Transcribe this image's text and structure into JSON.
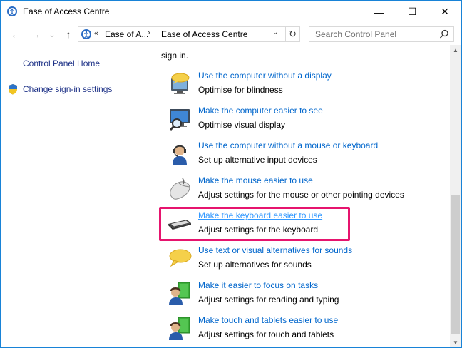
{
  "window": {
    "title": "Ease of Access Centre"
  },
  "nav": {
    "back_glyph": "←",
    "forward_glyph": "→",
    "dropdown_glyph": "⌄",
    "up_glyph": "↑"
  },
  "address": {
    "chevrons": "«",
    "crumbs": [
      "Ease of A...",
      "Ease of Access Centre"
    ],
    "separator": "›",
    "dropdown_glyph": "⌄",
    "refresh_glyph": "↻"
  },
  "search": {
    "placeholder": "Search Control Panel"
  },
  "left_pane": {
    "home": "Control Panel Home",
    "signin": "Change sign-in settings"
  },
  "content": {
    "clipped_text": "sign in.",
    "items": [
      {
        "title": "Use the computer without a display",
        "desc": "Optimise for blindness",
        "icon": "speech-bubble-monitor-icon"
      },
      {
        "title": "Make the computer easier to see",
        "desc": "Optimise visual display",
        "icon": "magnifier-monitor-icon"
      },
      {
        "title": "Use the computer without a mouse or keyboard",
        "desc": "Set up alternative input devices",
        "icon": "headset-person-icon"
      },
      {
        "title": "Make the mouse easier to use",
        "desc": "Adjust settings for the mouse or other pointing devices",
        "icon": "mouse-icon"
      },
      {
        "title": "Make the keyboard easier to use",
        "desc": "Adjust settings for the keyboard",
        "icon": "keyboard-icon"
      },
      {
        "title": "Use text or visual alternatives for sounds",
        "desc": "Set up alternatives for sounds",
        "icon": "speech-bubble-icon"
      },
      {
        "title": "Make it easier to focus on tasks",
        "desc": "Adjust settings for reading and typing",
        "icon": "person-green-panel-icon"
      },
      {
        "title": "Make touch and tablets easier to use",
        "desc": "Adjust settings for touch and tablets",
        "icon": "person-green-panel-icon"
      }
    ]
  },
  "window_controls": {
    "minimize": "—",
    "maximize": "☐",
    "close": "✕"
  },
  "scrollbar": {
    "up": "▲",
    "down": "▼"
  },
  "colors": {
    "link": "#0066cc",
    "highlight_border": "#e6146e",
    "window_border": "#1883d7"
  }
}
